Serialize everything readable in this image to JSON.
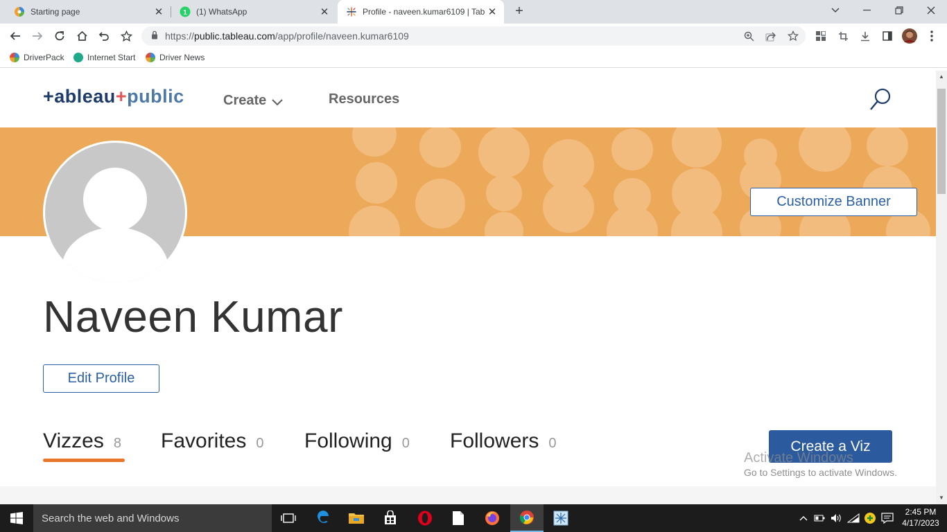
{
  "browser": {
    "tabs": [
      {
        "title": "Starting page",
        "active": false
      },
      {
        "title": "(1) WhatsApp",
        "active": false
      },
      {
        "title": "Profile - naveen.kumar6109 | Tab",
        "active": true
      }
    ],
    "url": {
      "scheme": "https://",
      "host": "public.tableau.com",
      "path": "/app/profile/naveen.kumar6109"
    },
    "bookmarks": [
      {
        "label": "DriverPack"
      },
      {
        "label": "Internet Start"
      },
      {
        "label": "Driver News"
      }
    ]
  },
  "site": {
    "logo_main": "+ableau",
    "logo_plus": "+",
    "logo_pub": "public",
    "nav": {
      "create": "Create",
      "resources": "Resources"
    }
  },
  "profile": {
    "customize_banner": "Customize Banner",
    "name": "Naveen Kumar",
    "edit_profile": "Edit Profile",
    "tabs": [
      {
        "label": "Vizzes",
        "count": "8"
      },
      {
        "label": "Favorites",
        "count": "0"
      },
      {
        "label": "Following",
        "count": "0"
      },
      {
        "label": "Followers",
        "count": "0"
      }
    ],
    "create_viz": "Create a Viz",
    "banner_color": "#eda95a",
    "accent_color": "#2b5a9e",
    "active_tab_underline": "#e8762d"
  },
  "watermark": {
    "line1": "Activate Windows",
    "line2": "Go to Settings to activate Windows."
  },
  "taskbar": {
    "search_placeholder": "Search the web and Windows",
    "time": "2:45 PM",
    "date": "4/17/2023"
  }
}
